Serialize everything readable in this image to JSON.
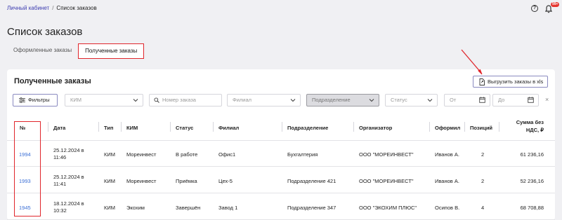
{
  "breadcrumb": {
    "home": "Личный кабинет",
    "separator": "/",
    "current": "Список заказов"
  },
  "header": {
    "help_glyph": "?",
    "notifications_badge": "99+"
  },
  "page_title": "Список заказов",
  "tabs": [
    {
      "label": "Оформленные заказы",
      "active": false
    },
    {
      "label": "Полученные заказы",
      "active": true
    }
  ],
  "card": {
    "title": "Полученные заказы",
    "export_label": "Выгрузить заказы в xls"
  },
  "filters": {
    "filters_button": "Фильтры",
    "kim_placeholder": "КИМ",
    "order_number_placeholder": "Номер заказа",
    "branch_placeholder": "Филиал",
    "department_placeholder": "Подразделение",
    "status_placeholder": "Статус",
    "date_from_placeholder": "От",
    "date_to_placeholder": "До",
    "clear_glyph": "×"
  },
  "table": {
    "columns": [
      "№",
      "Дата",
      "Тип",
      "КИМ",
      "Статус",
      "Филиал",
      "Подразделение",
      "Организатор",
      "Оформил",
      "Позиций",
      "Сумма без",
      "НДС, ₽"
    ],
    "rows": [
      {
        "num": "1994",
        "date_line1": "25.12.2024 в",
        "date_line2": "11:46",
        "type": "КИМ",
        "kim": "Мореинвест",
        "status": "В работе",
        "branch": "Офис1",
        "department": "Бухгалтерия",
        "organizer": "ООО \"МОРЕИНВЕСТ\"",
        "issued_by": "Иванов А.",
        "positions": "2",
        "sum": "61 236,16"
      },
      {
        "num": "1993",
        "date_line1": "25.12.2024 в",
        "date_line2": "11:41",
        "type": "КИМ",
        "kim": "Мореинвест",
        "status": "Приёмка",
        "branch": "Цех-5",
        "department": "Подразделение 421",
        "organizer": "ООО \"МОРЕИНВЕСТ\"",
        "issued_by": "Иванов А.",
        "positions": "2",
        "sum": "52 236,16"
      },
      {
        "num": "1945",
        "date_line1": "18.12.2024 в",
        "date_line2": "10:32",
        "type": "КИМ",
        "kim": "Экохим",
        "status": "Завершён",
        "branch": "Завод 1",
        "department": "Подразделение 347",
        "organizer": "ООО \"ЭКОХИМ ПЛЮС\"",
        "issued_by": "Осипов В.",
        "positions": "4",
        "sum": "68 708,88"
      }
    ]
  },
  "colors": {
    "accent": "#3b6fd6",
    "highlight": "#e0252b",
    "link": "#3b3bb0"
  }
}
